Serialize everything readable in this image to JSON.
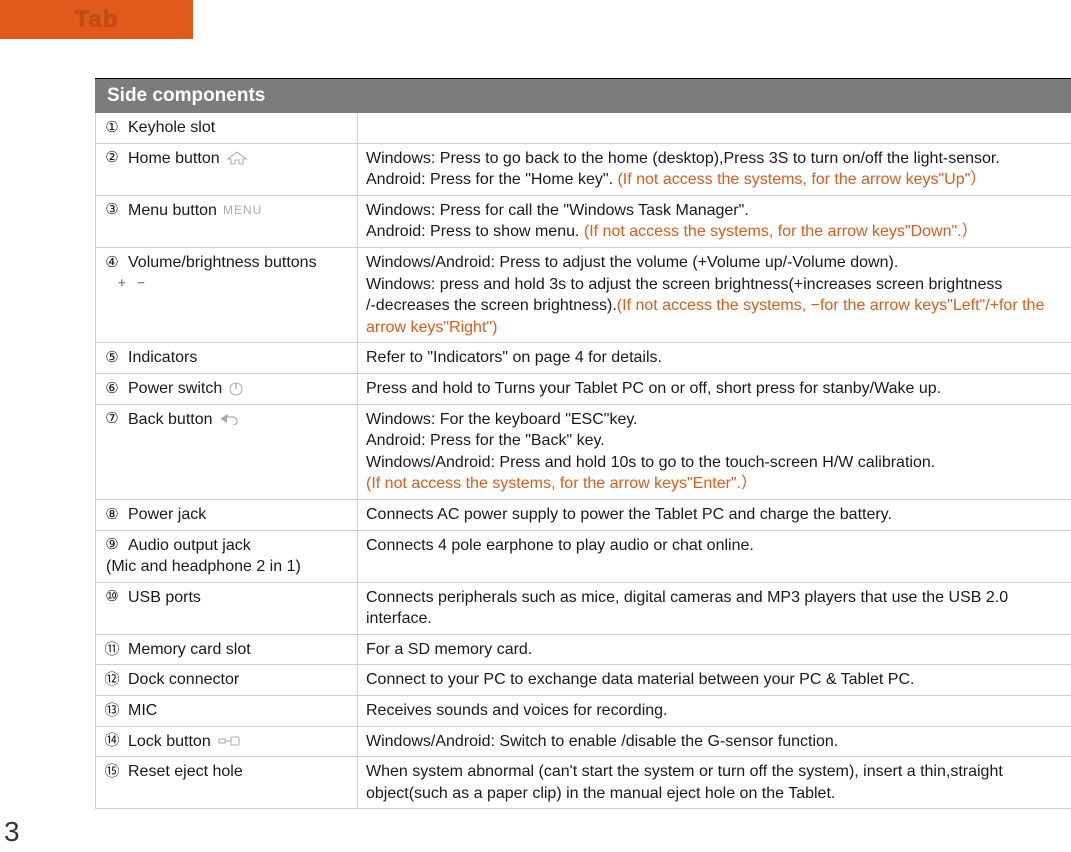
{
  "tab_label": "Tab",
  "header": "Side components",
  "page_number": "3",
  "rows": [
    {
      "num": "①",
      "label": "Keyhole slot",
      "desc": ""
    },
    {
      "num": "②",
      "label": "Home button",
      "desc_pre_a": "Windows: Press to go back to the home (desktop),Press 3S to turn on/off the light-sensor.",
      "desc_pre_b": "Android: Press for the \"Home key\".",
      "desc_accent": "(If not access  the systems,  for the arrow keys\"Up\"）"
    },
    {
      "num": "③",
      "label": "Menu button",
      "icon_label": "MENU",
      "desc_a": "Windows: Press for call the \"Windows Task Manager\".",
      "desc_b": "Android: Press to show menu. ",
      "desc_accent": "(If not access the systems, for the arrow keys\"Down\".）"
    },
    {
      "num": "④",
      "label": "Volume/brightness buttons",
      "desc_a": "Windows/Android: Press to adjust the volume (+Volume up/-Volume down).",
      "desc_b": "Windows: press and hold 3s to adjust the screen brightness(+increases screen  brightness",
      "desc_c": "/-decreases the screen brightness).",
      "desc_accent": "(If not access  the systems,  −for the arrow keys\"Left\"/+for the arrow keys\"Right\")"
    },
    {
      "num": "⑤",
      "label": "Indicators",
      "desc": "Refer to \"Indicators\" on page 4 for details."
    },
    {
      "num": "⑥",
      "label": "Power switch",
      "desc": "Press and hold to Turns your Tablet PC on or off, short press for stanby/Wake up."
    },
    {
      "num": "⑦",
      "label": "Back button",
      "desc_a": "Windows: For the keyboard \"ESC\"key.",
      "desc_b": "Android: Press for the \"Back\" key.",
      "desc_c": "Windows/Android: Press and hold 10s to go to the touch-screen H/W calibration.",
      "desc_accent": "(If not access the systems,  for the arrow keys\"Enter\".）"
    },
    {
      "num": "⑧",
      "label": "Power jack",
      "desc": "Connects AC power supply to power the Tablet PC and charge the battery."
    },
    {
      "num": "⑨",
      "label": "Audio output jack",
      "sublabel": "(Mic and headphone 2 in 1)",
      "desc": "Connects 4 pole earphone to play audio or chat online."
    },
    {
      "num": "⑩",
      "label": "USB ports",
      "desc": "Connects peripherals such as mice, digital cameras and MP3 players that use the USB 2.0 interface."
    },
    {
      "num": "⑪",
      "label": "Memory card slot",
      "desc": "For a SD memory card."
    },
    {
      "num": "⑫",
      "label": "Dock connector",
      "desc": "Connect to your PC to exchange data material between your PC & Tablet PC."
    },
    {
      "num": "⑬",
      "label": "MIC",
      "desc": "Receives sounds and voices for recording."
    },
    {
      "num": "⑭",
      "label": "Lock button",
      "desc": "Windows/Android: Switch to enable /disable the G-sensor function."
    },
    {
      "num": "⑮",
      "label": "Reset eject hole",
      "desc": "When system abnormal (can't start the system or turn off the system), insert a thin,straight object(such as a paper clip) in the manual eject hole on the Tablet."
    }
  ]
}
